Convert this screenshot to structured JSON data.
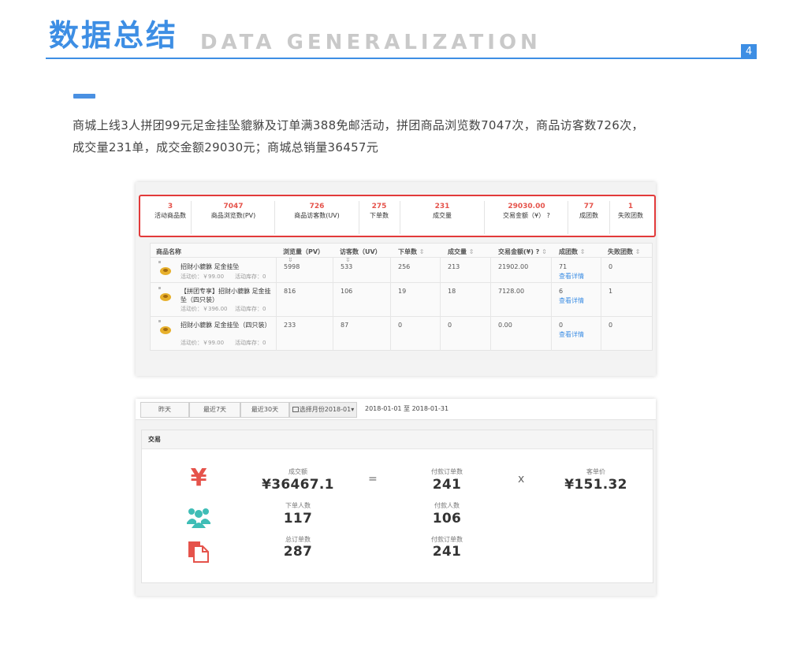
{
  "header": {
    "title": "数据总结",
    "subtitle": "DATA GENERALIZATION",
    "page_number": "4"
  },
  "description": {
    "line1": "商城上线3人拼团99元足金挂坠貔貅及订单满388免邮活动，拼团商品浏览数7047次，商品访客数726次，",
    "line2": "成交量231单，成交金额29030元；商城总销量36457元"
  },
  "summary_stats": [
    {
      "value": "3",
      "label": "活动商品数"
    },
    {
      "value": "7047",
      "label": "商品浏览数(PV)"
    },
    {
      "value": "726",
      "label": "商品访客数(UV)"
    },
    {
      "value": "275",
      "label": "下单数"
    },
    {
      "value": "231",
      "label": "成交量"
    },
    {
      "value": "29030.00",
      "label": "交易金额（¥） ?"
    },
    {
      "value": "77",
      "label": "成团数"
    },
    {
      "value": "1",
      "label": "失败团数"
    }
  ],
  "product_table": {
    "headers": [
      "商品名称",
      "浏览量（PV）",
      "访客数（UV）",
      "下单数",
      "成交量",
      "交易金额(¥) ?",
      "成团数",
      "失败团数"
    ],
    "sort_icon": "⇕",
    "detail_link": "查看详情",
    "rows": [
      {
        "name": "招财小貔貅 足金挂坠",
        "price": "活动价：￥99.00",
        "stock": "活动库存：0",
        "pv": "5998",
        "uv": "533",
        "orders": "256",
        "deals": "213",
        "amount": "21902.00",
        "groups": "71",
        "failed": "0"
      },
      {
        "name": "【拼团专享】招财小貔貅 足金挂坠（四只装）",
        "price": "活动价：￥396.00",
        "stock": "活动库存：0",
        "pv": "816",
        "uv": "106",
        "orders": "19",
        "deals": "18",
        "amount": "7128.00",
        "groups": "6",
        "failed": "1"
      },
      {
        "name": "招财小貔貅 足金挂坠（四只装）",
        "price": "活动价：￥99.00",
        "stock": "活动库存：0",
        "pv": "233",
        "uv": "87",
        "orders": "0",
        "deals": "0",
        "amount": "0.00",
        "groups": "0",
        "failed": "0"
      }
    ]
  },
  "filter_tabs": {
    "yesterday": "昨天",
    "last7": "最近7天",
    "last30": "最近30天",
    "month_picker": "选择月份2018-01▾",
    "range": "2018-01-01 至 2018-01-31"
  },
  "trade_card": {
    "title": "交易",
    "operators": {
      "equals": "=",
      "times": "x"
    },
    "icons": {
      "money": "yen-icon",
      "people": "users-icon",
      "orders": "document-icon"
    },
    "accent_colors": {
      "money": "#e5534b",
      "people": "#3fbdb6",
      "orders": "#e5534b"
    },
    "metrics": {
      "gmv": {
        "label": "成交额",
        "value": "¥36467.1"
      },
      "paid_orders": {
        "label": "付款订单数",
        "value": "241"
      },
      "avg_price": {
        "label": "客单价",
        "value": "¥151.32"
      },
      "buyers": {
        "label": "下单人数",
        "value": "117"
      },
      "payers": {
        "label": "付款人数",
        "value": "106"
      },
      "total_orders": {
        "label": "总订单数",
        "value": "287"
      },
      "paid_orders2": {
        "label": "付款订单数",
        "value": "241"
      }
    }
  }
}
